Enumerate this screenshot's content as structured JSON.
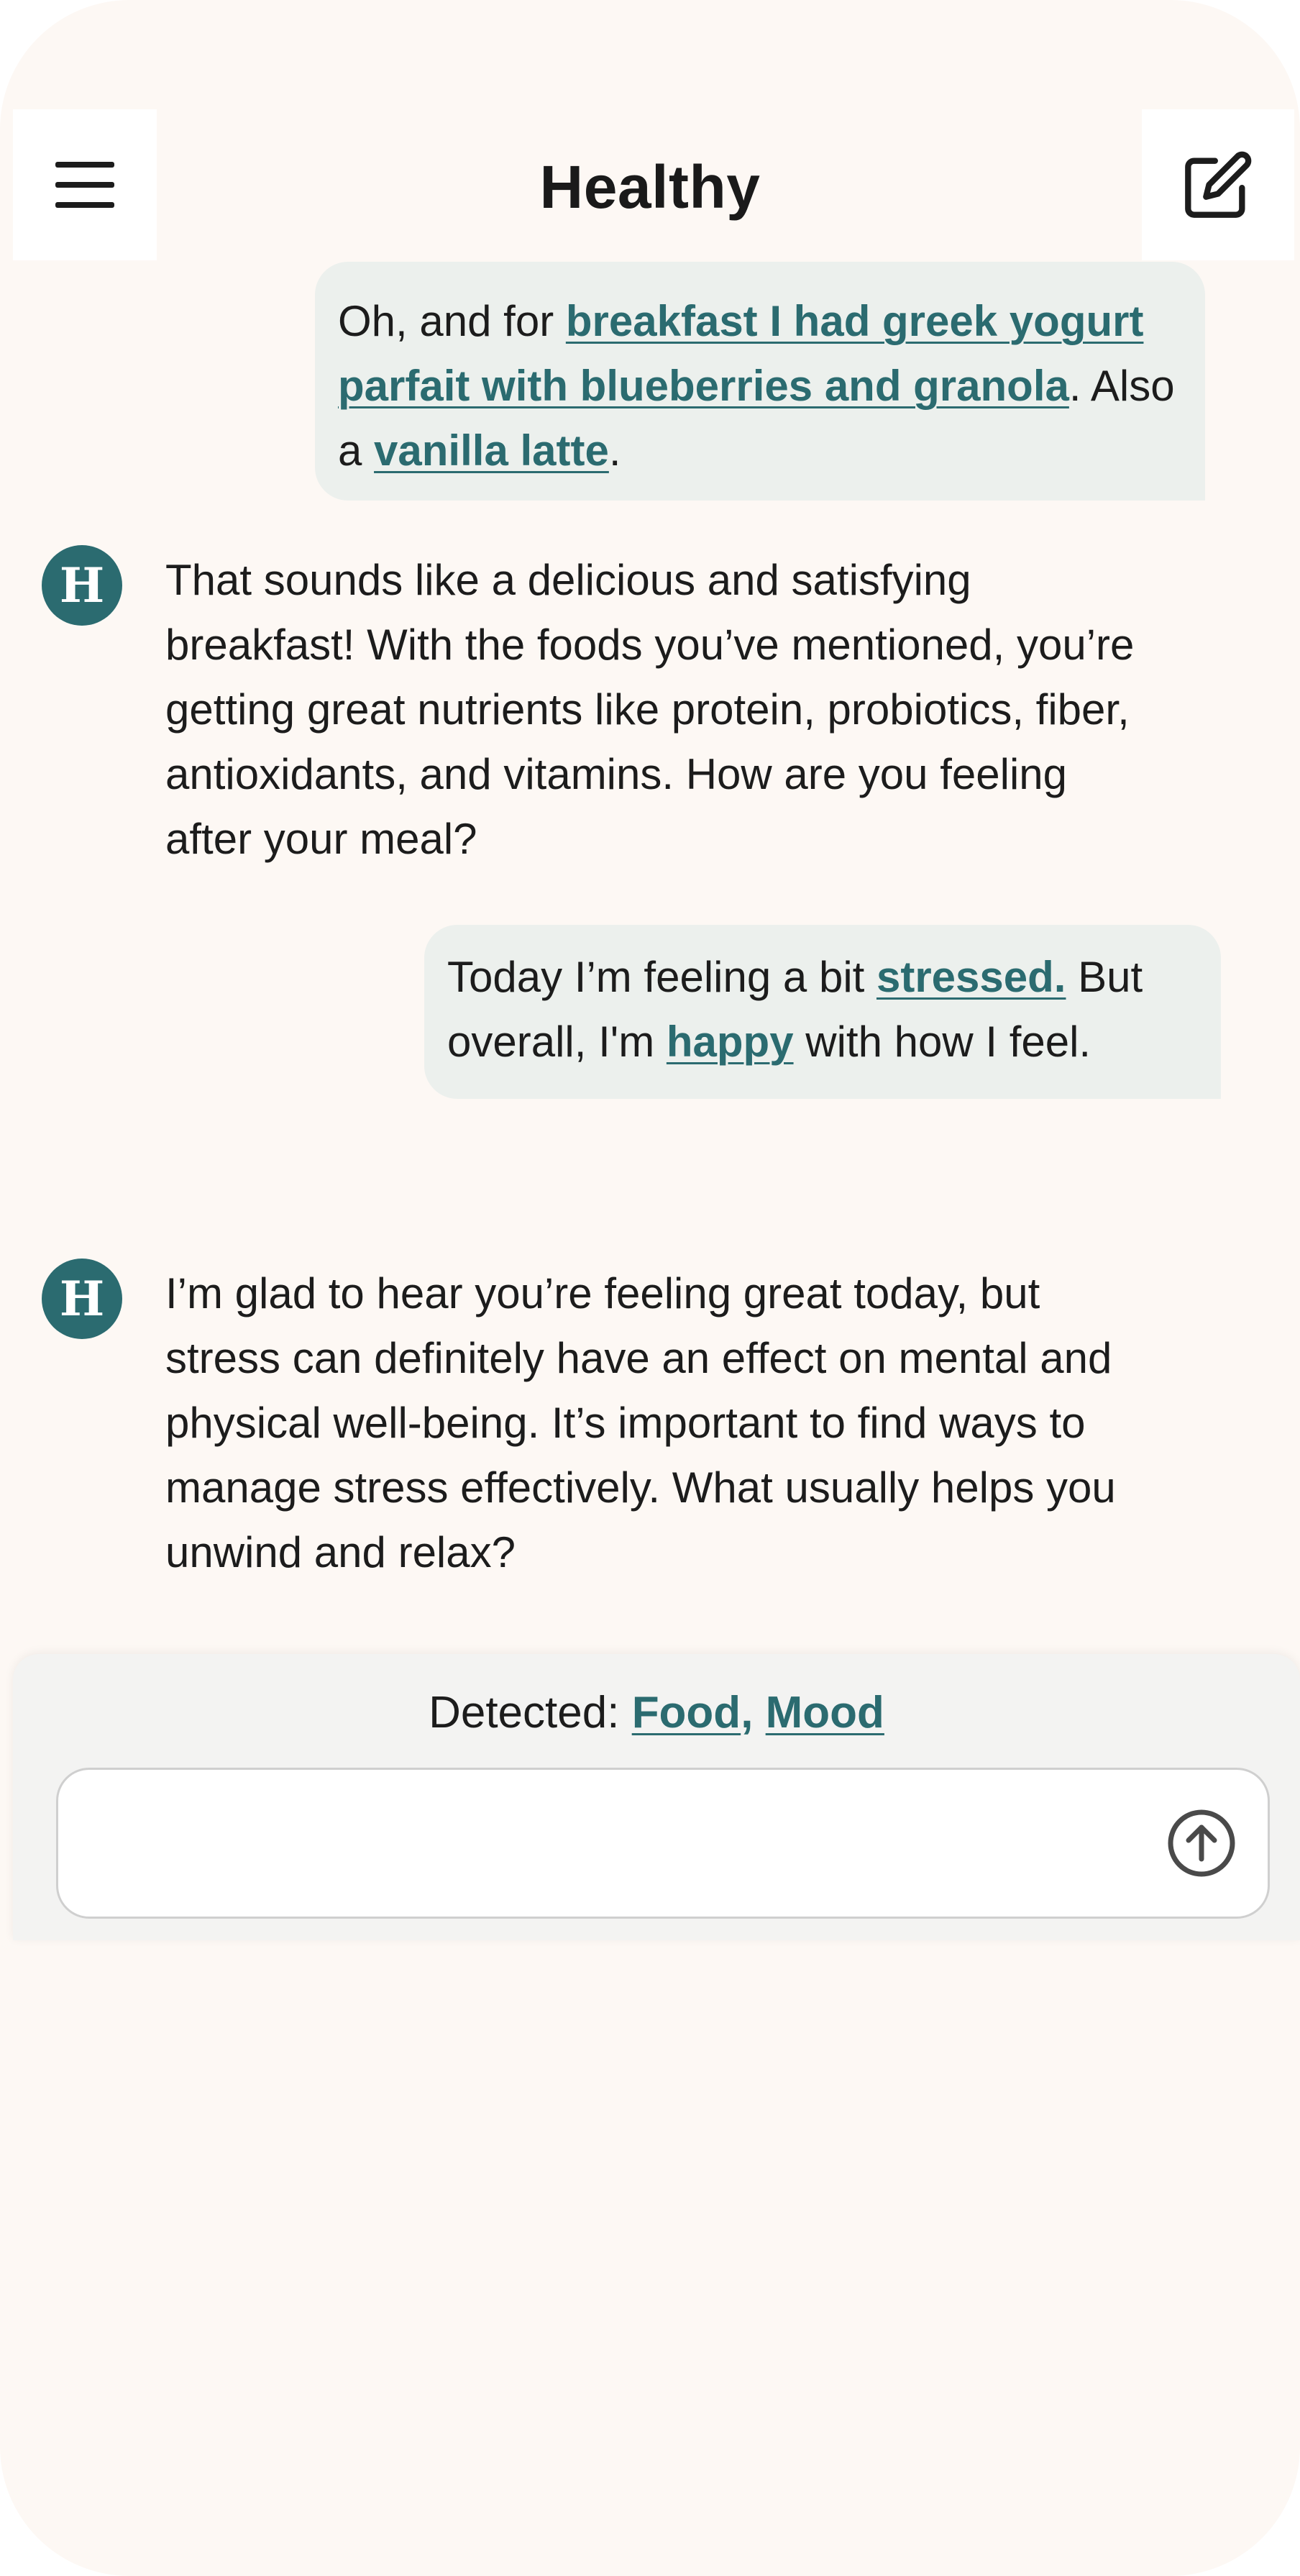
{
  "header": {
    "title": "Healthy",
    "menu_icon": "hamburger-menu-icon",
    "compose_icon": "edit-compose-icon"
  },
  "colors": {
    "background": "#fdf8f4",
    "accent": "#2b6b70",
    "user_bubble": "#ecf0ed"
  },
  "messages": [
    {
      "role": "user",
      "segments": [
        {
          "text": "Oh, and for ",
          "link": false
        },
        {
          "text": "breakfast I had greek yogurt parfait with blueberries and granola",
          "link": true
        },
        {
          "text": ". Also a ",
          "link": false
        },
        {
          "text": "vanilla latte",
          "link": true
        },
        {
          "text": ".",
          "link": false
        }
      ]
    },
    {
      "role": "assistant",
      "avatar_letter": "H",
      "text": "That sounds like a delicious and satisfying breakfast! With the foods you’ve mentioned, you’re getting great nutrients like protein, probiotics, fiber, antioxidants, and vitamins. How are you feeling after your meal?"
    },
    {
      "role": "user",
      "segments": [
        {
          "text": "Today I’m feeling a bit ",
          "link": false
        },
        {
          "text": "stressed.",
          "link": true
        },
        {
          "text": " But overall, I'm ",
          "link": false
        },
        {
          "text": "happy",
          "link": true
        },
        {
          "text": " with how I feel.",
          "link": false
        }
      ]
    },
    {
      "role": "assistant",
      "avatar_letter": "H",
      "text": "I’m glad to hear you’re feeling great today, but stress can definitely have an effect on mental and physical well-being. It’s important to find ways to manage stress effectively. What usually helps you unwind and relax?"
    }
  ],
  "composer": {
    "detected_label": "Detected:",
    "detected_tags": [
      "Food",
      "Mood"
    ],
    "detected_separator": ",",
    "input_value": "",
    "input_placeholder": "",
    "send_icon": "arrow-up-circle-icon"
  }
}
